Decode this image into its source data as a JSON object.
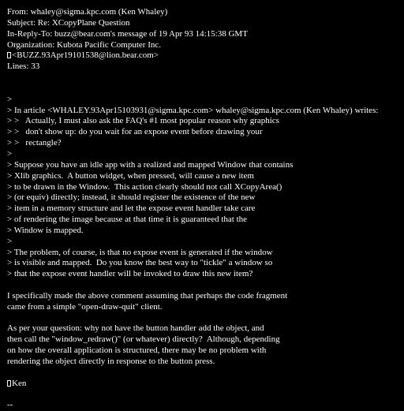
{
  "headers": {
    "from": "From: whaley@sigma.kpc.com (Ken Whaley)",
    "subject": "Subject: Re: XCopyPlane Question",
    "in_reply_to": "In-Reply-To: buzz@bear.com's message of 19 Apr 93 14:15:38 GMT",
    "organization": "Organization: Kubota Pacific Computer Inc.",
    "references": "<BUZZ.93Apr19101538@lion.bear.com>",
    "lines": "Lines: 33"
  },
  "body": {
    "q0": ">",
    "q1": "> In article <WHALEY.93Apr15103931@sigma.kpc.com> whaley@sigma.kpc.com (Ken Whaley) writes:",
    "q2": "> >   Actually, I must also ask the FAQ's #1 most popular reason why graphics",
    "q3": "> >   don't show up: do you wait for an expose event before drawing your",
    "q4": "> >   rectangle?",
    "q5": ">",
    "q6": "> Suppose you have an idle app with a realized and mapped Window that contains",
    "q7": "> Xlib graphics.  A button widget, when pressed, will cause a new item",
    "q8": "> to be drawn in the Window.  This action clearly should not call XCopyArea()",
    "q9": "> (or equiv) directly; instead, it should register the existence of the new",
    "q10": "> item in a memory structure and let the expose event handler take care",
    "q11": "> of rendering the image because at that time it is guaranteed that the",
    "q12": "> Window is mapped.",
    "q13": ">",
    "q14": "> The problem, of course, is that no expose event is generated if the window",
    "q15": "> is visible and mapped.  Do you know the best way to \"tickle\" a window so",
    "q16": "> that the expose event handler will be invoked to draw this new item?",
    "p1a": "I specifically made the above comment assuming that perhaps the code fragment",
    "p1b": "came from a simple \"open-draw-quit\" client.",
    "p2a": "As per your question: why not have the button handler add the object, and",
    "p2b": "then call the \"window_redraw()\" (or whatever) directly?  Although, depending",
    "p2c": "on how the overall application is structured, there may be no problem with",
    "p2d": "rendering the object directly in response to the button press.",
    "signoff": "Ken",
    "sig_sep": "--"
  },
  "colors": {
    "background": "#000000",
    "text": "#ffffff"
  }
}
